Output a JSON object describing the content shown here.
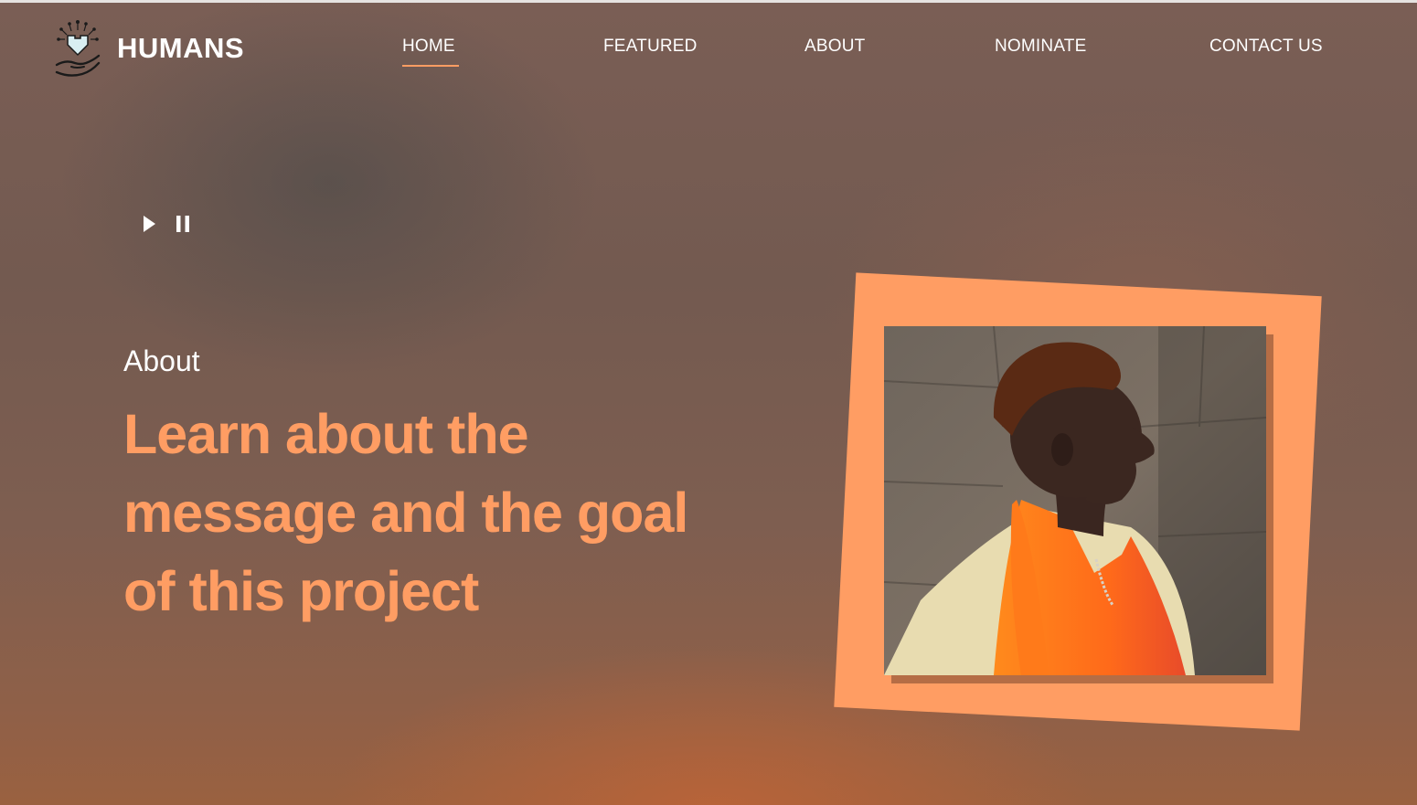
{
  "brand": {
    "name": "HUMANS",
    "logo_icon": "heart-hand-icon"
  },
  "nav": {
    "items": [
      {
        "label": "HOME",
        "active": true
      },
      {
        "label": "FEATURED",
        "active": false
      },
      {
        "label": "ABOUT",
        "active": false
      },
      {
        "label": "NOMINATE",
        "active": false
      },
      {
        "label": "CONTACT US",
        "active": false
      }
    ]
  },
  "media_controls": {
    "play_icon": "play-icon",
    "pause_icon": "pause-icon"
  },
  "hero": {
    "section_label": "About",
    "headline": "Learn about the message and the goal of this project",
    "image_icon": "portrait-photo"
  },
  "colors": {
    "accent": "#ff9d63",
    "text": "#ffffff",
    "background": "#7a5e55"
  }
}
